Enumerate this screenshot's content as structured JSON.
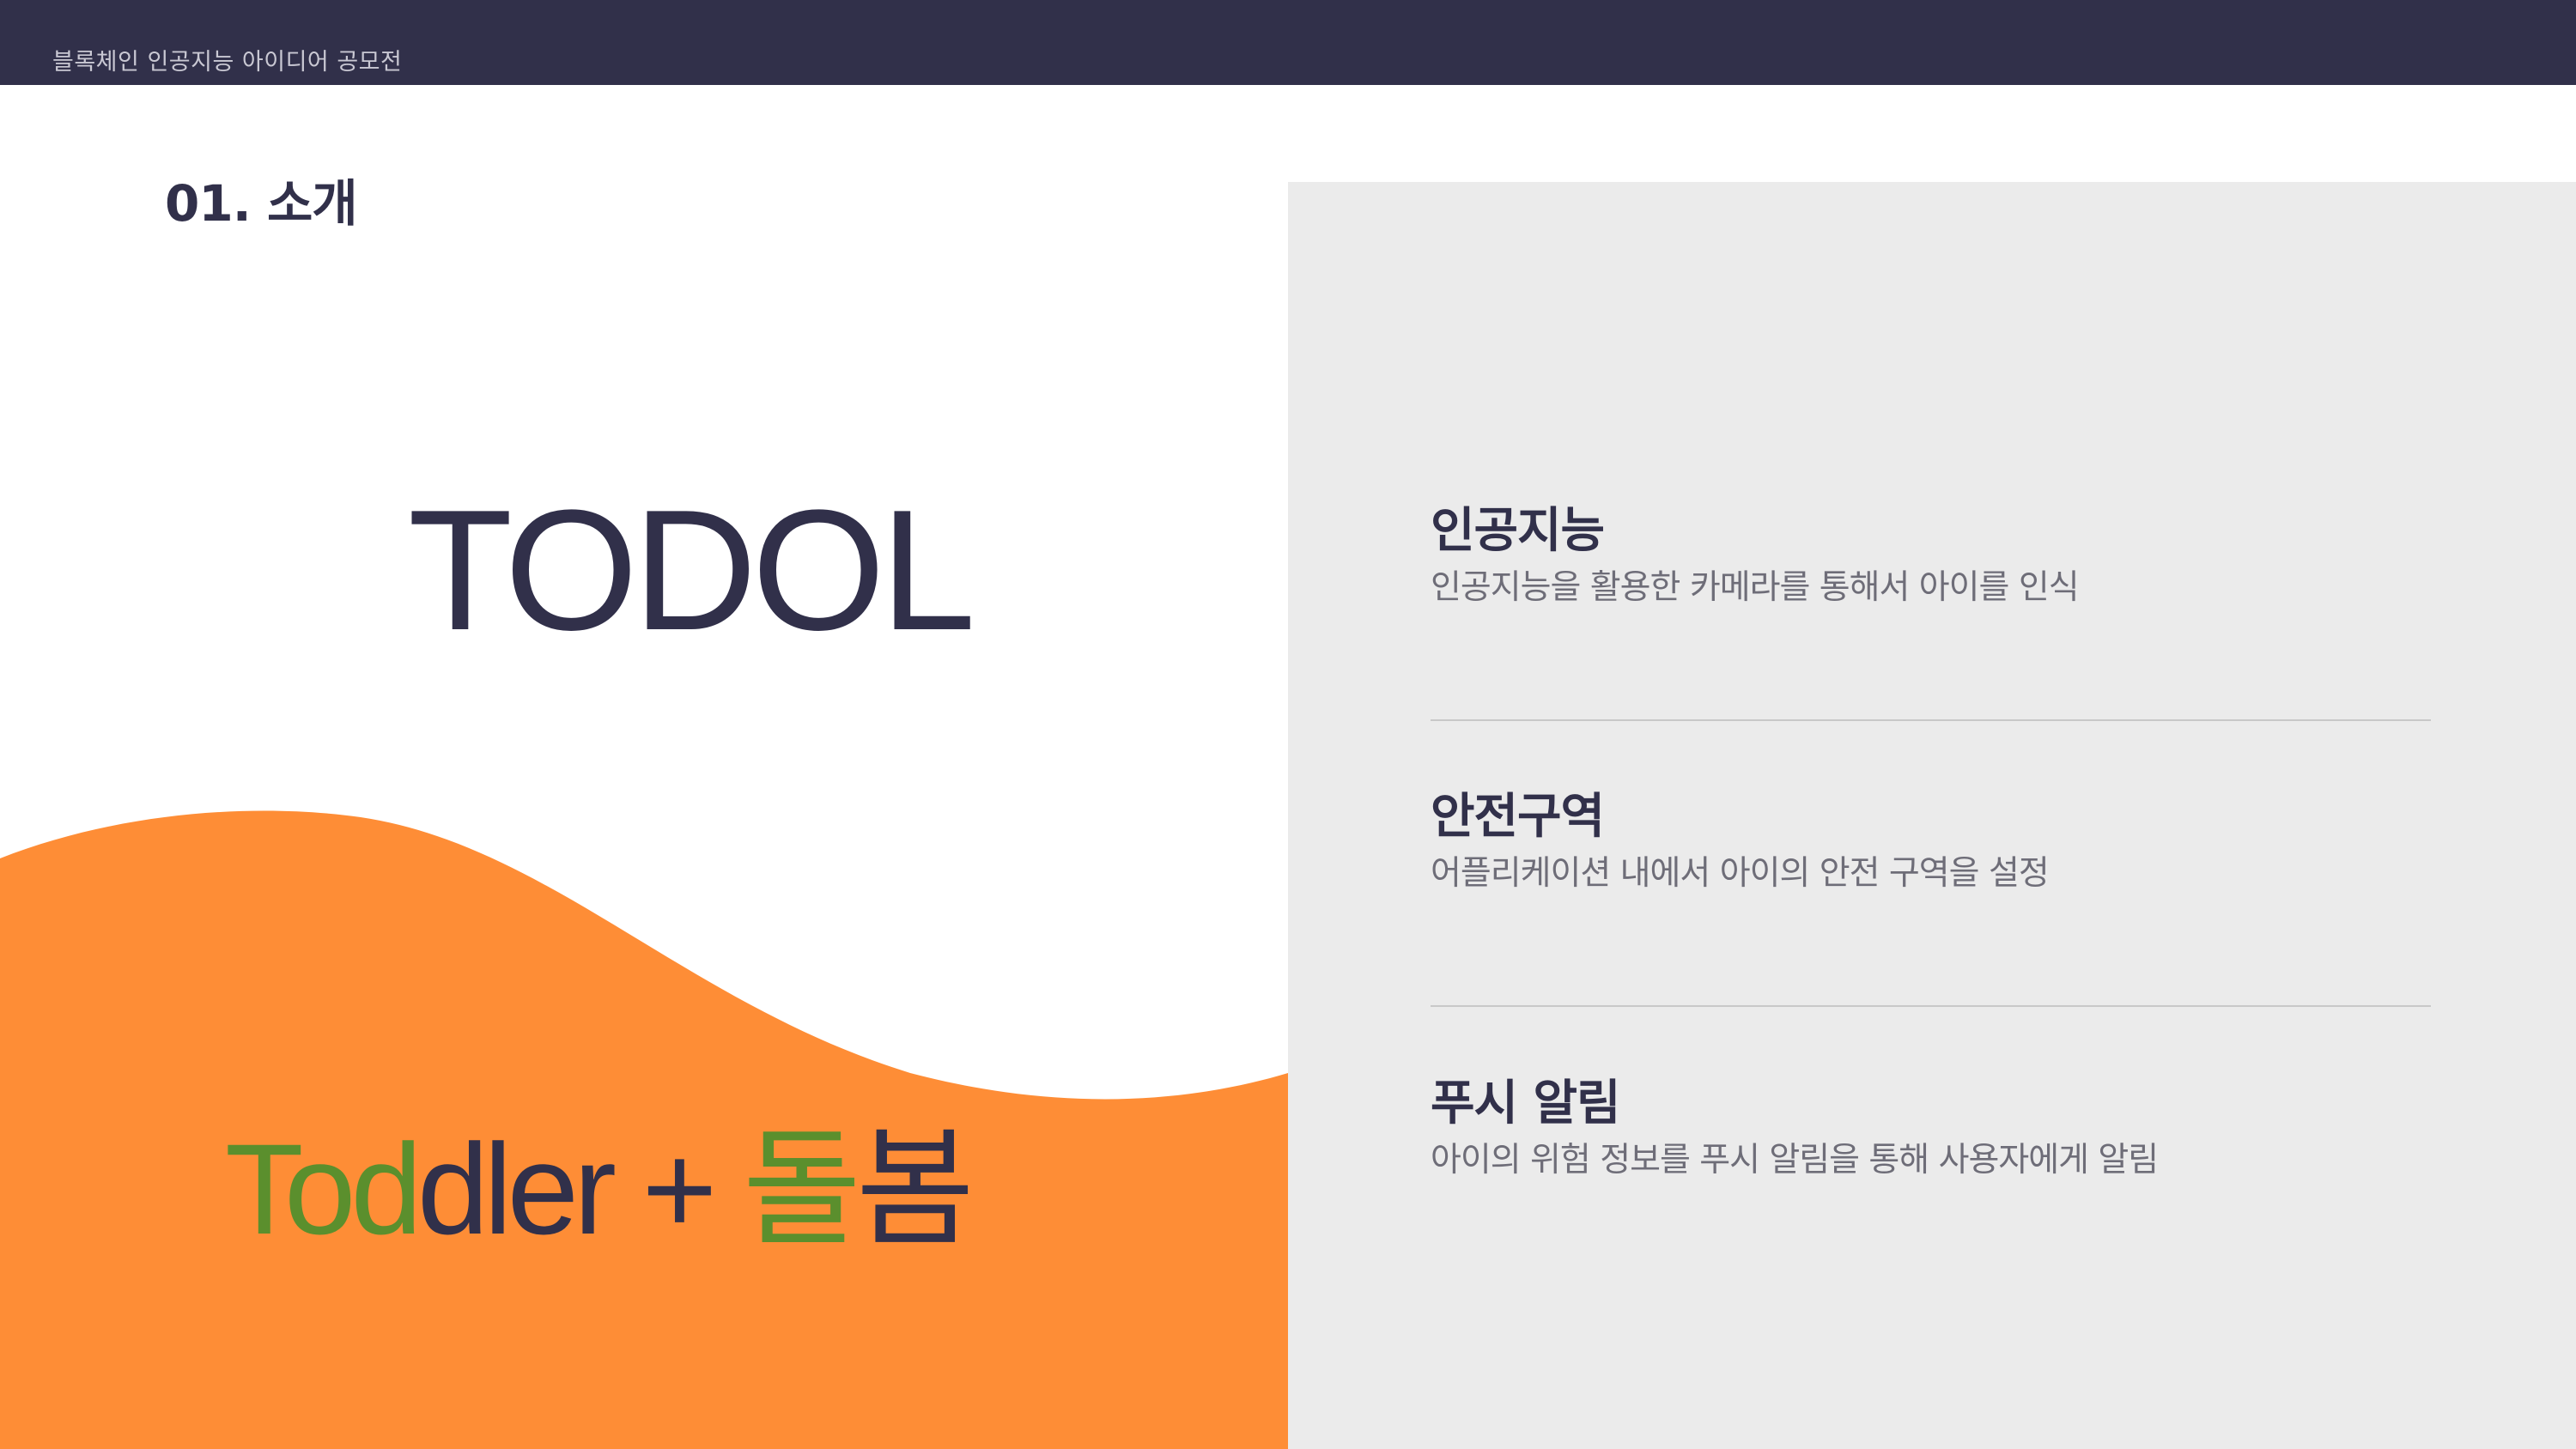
{
  "header": {
    "title": "블록체인 인공지능 아이디어 공모전"
  },
  "section": {
    "title": "01. 소개"
  },
  "logo": {
    "text": "TODOL"
  },
  "slogan": {
    "part1_green": "Tod",
    "part1_navy": "dler + ",
    "part2_green": "돌",
    "part2_navy": "봄"
  },
  "features": [
    {
      "title": "인공지능",
      "description": "인공지능을 활용한 카메라를 통해서 아이를 인식"
    },
    {
      "title": "안전구역",
      "description": "어플리케이션 내에서 아이의 안전 구역을 설정"
    },
    {
      "title": "푸시 알림",
      "description": "아이의 위험 정보를 푸시 알림을 통해 사용자에게 알림"
    }
  ],
  "colors": {
    "navy": "#31304a",
    "orange": "#fe8d36",
    "green": "#5b8f2d",
    "panel_gray": "#ebebeb"
  }
}
